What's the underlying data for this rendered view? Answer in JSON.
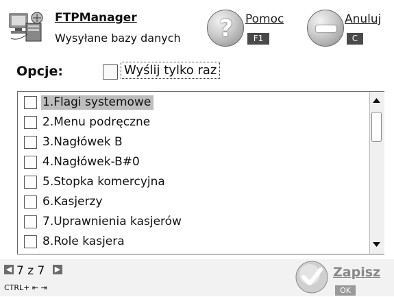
{
  "header": {
    "title": "FTPManager",
    "subtitle": "Wysyłane bazy danych",
    "help": {
      "label": "Pomoc",
      "key": "F1"
    },
    "cancel": {
      "label": "Anuluj",
      "key": "C"
    }
  },
  "options": {
    "label": "Opcje:",
    "send_once_label": "Wyślij tylko raz",
    "send_once_checked": false
  },
  "list": {
    "items": [
      {
        "label": "1.Flagi systemowe",
        "checked": false,
        "selected": true
      },
      {
        "label": "2.Menu podręczne",
        "checked": false,
        "selected": false
      },
      {
        "label": "3.Nagłówek B",
        "checked": false,
        "selected": false
      },
      {
        "label": "4.Nagłówek-B#0",
        "checked": false,
        "selected": false
      },
      {
        "label": "5.Stopka komercyjna",
        "checked": false,
        "selected": false
      },
      {
        "label": "6.Kasjerzy",
        "checked": false,
        "selected": false
      },
      {
        "label": "7.Uprawnienia kasjerów",
        "checked": false,
        "selected": false
      },
      {
        "label": "8.Role kasjera",
        "checked": false,
        "selected": false
      }
    ]
  },
  "footer": {
    "page": "7 z 7",
    "shortcut": "CTRL+ ⇤ ⇥",
    "save": {
      "label": "Zapisz",
      "key": "OK"
    }
  },
  "icons": {
    "app": "computer-network-icon",
    "help": "question-icon",
    "cancel": "minus-icon",
    "prev": "arrow-left-icon",
    "next": "arrow-right-icon",
    "save": "checkmark-icon",
    "scroll_up": "triangle-up-icon",
    "scroll_down": "triangle-down-icon"
  },
  "colors": {
    "selection": "#bdbdbd",
    "key_badge": "#4a4a4a"
  }
}
